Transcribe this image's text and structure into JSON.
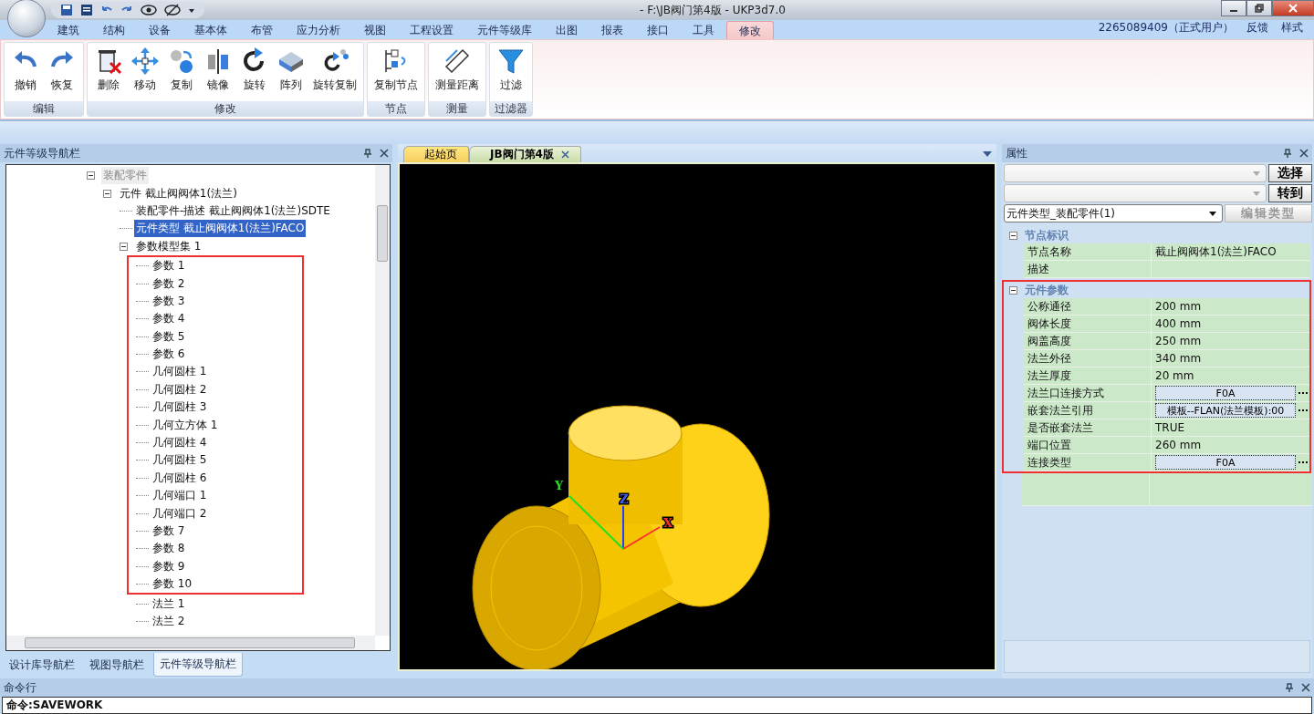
{
  "window": {
    "title": "- F:\\JB阀门第4版 - UKP3d7.0"
  },
  "menu": {
    "tabs": [
      {
        "label": "建筑",
        "selected": false
      },
      {
        "label": "结构",
        "selected": false
      },
      {
        "label": "设备",
        "selected": false
      },
      {
        "label": "基本体",
        "selected": false
      },
      {
        "label": "布管",
        "selected": false
      },
      {
        "label": "应力分析",
        "selected": false
      },
      {
        "label": "视图",
        "selected": false
      },
      {
        "label": "工程设置",
        "selected": false
      },
      {
        "label": "元件等级库",
        "selected": false
      },
      {
        "label": "出图",
        "selected": false
      },
      {
        "label": "报表",
        "selected": false
      },
      {
        "label": "接口",
        "selected": false
      },
      {
        "label": "工具",
        "selected": false
      },
      {
        "label": "修改",
        "selected": true
      }
    ],
    "user": "2265089409（正式用户）",
    "links": [
      "反馈",
      "样式"
    ]
  },
  "ribbon": {
    "groups": [
      {
        "label": "编辑",
        "buttons": [
          {
            "label": "撤销",
            "kind": "undo"
          },
          {
            "label": "恢复",
            "kind": "redo"
          }
        ]
      },
      {
        "label": "修改",
        "buttons": [
          {
            "label": "删除",
            "kind": "delete"
          },
          {
            "label": "移动",
            "kind": "move"
          },
          {
            "label": "复制",
            "kind": "copy"
          },
          {
            "label": "镜像",
            "kind": "mirror"
          },
          {
            "label": "旋转",
            "kind": "rotate"
          },
          {
            "label": "阵列",
            "kind": "array"
          },
          {
            "label": "旋转复制",
            "kind": "rotatecopy"
          }
        ]
      },
      {
        "label": "节点",
        "buttons": [
          {
            "label": "复制节点",
            "kind": "copynode"
          }
        ]
      },
      {
        "label": "测量",
        "buttons": [
          {
            "label": "测量距离",
            "kind": "measure"
          }
        ]
      },
      {
        "label": "过滤器",
        "buttons": [
          {
            "label": "过滤",
            "kind": "filter"
          }
        ]
      }
    ]
  },
  "left_panel": {
    "title": "元件等级导航栏",
    "tree": [
      {
        "label": "装配零件",
        "dimmed": true,
        "expanded": true,
        "children": [
          {
            "label": "元件 截止阀阀体1(法兰)",
            "selected": false,
            "expanded": true,
            "children": [
              {
                "label": "装配零件-描述 截止阀阀体1(法兰)SDTE",
                "selected": false
              },
              {
                "label": "元件类型 截止阀阀体1(法兰)FACO",
                "selected": true
              },
              {
                "label": "参数模型集 1",
                "selected": false,
                "expanded": true,
                "children": [
                  {
                    "label": "参数 1",
                    "annotated": true
                  },
                  {
                    "label": "参数 2",
                    "annotated": true
                  },
                  {
                    "label": "参数 3",
                    "annotated": true
                  },
                  {
                    "label": "参数 4",
                    "annotated": true
                  },
                  {
                    "label": "参数 5",
                    "annotated": true
                  },
                  {
                    "label": "参数 6",
                    "annotated": true
                  },
                  {
                    "label": "几何圆柱 1",
                    "annotated": true
                  },
                  {
                    "label": "几何圆柱 2",
                    "annotated": true
                  },
                  {
                    "label": "几何圆柱 3",
                    "annotated": true
                  },
                  {
                    "label": "几何立方体 1",
                    "annotated": true
                  },
                  {
                    "label": "几何圆柱 4",
                    "annotated": true
                  },
                  {
                    "label": "几何圆柱 5",
                    "annotated": true
                  },
                  {
                    "label": "几何圆柱 6",
                    "annotated": true
                  },
                  {
                    "label": "几何端口 1",
                    "annotated": true
                  },
                  {
                    "label": "几何端口 2",
                    "annotated": true
                  },
                  {
                    "label": "参数 7",
                    "annotated": true
                  },
                  {
                    "label": "参数 8",
                    "annotated": true
                  },
                  {
                    "label": "参数 9",
                    "annotated": true
                  },
                  {
                    "label": "参数 10",
                    "annotated": true
                  },
                  {
                    "label": "法兰 1",
                    "annotated": false
                  },
                  {
                    "label": "法兰 2",
                    "annotated": false
                  }
                ]
              }
            ]
          }
        ]
      }
    ],
    "tabs": [
      {
        "label": "设计库导航栏",
        "selected": false
      },
      {
        "label": "视图导航栏",
        "selected": false
      },
      {
        "label": "元件等级导航栏",
        "selected": true
      }
    ]
  },
  "document_tabs": [
    {
      "label": "起始页",
      "selected": false
    },
    {
      "label": "JB阀门第4版",
      "selected": true
    }
  ],
  "viewport": {
    "axes": [
      "Z",
      "Y",
      "X"
    ]
  },
  "properties": {
    "title": "属性",
    "buttons": [
      "选择",
      "转到"
    ],
    "type_combo": "元件类型_装配零件(1)",
    "edit_button": {
      "label": "编辑类型",
      "disabled": true
    },
    "sections": [
      {
        "title": "节点标识",
        "expanded": true,
        "annotated": false,
        "rows": [
          {
            "name": "节点名称",
            "value": "截止阀阀体1(法兰)FACO",
            "kind": "text"
          },
          {
            "name": "描述",
            "kind": "text"
          }
        ]
      },
      {
        "title": "元件参数",
        "expanded": true,
        "annotated": true,
        "rows": [
          {
            "name": "公称通径",
            "value": "200 mm",
            "kind": "text"
          },
          {
            "name": "阀体长度",
            "value": "400 mm",
            "kind": "text"
          },
          {
            "name": "阀盖高度",
            "value": "250 mm",
            "kind": "text"
          },
          {
            "name": "法兰外径",
            "value": "340 mm",
            "kind": "text"
          },
          {
            "name": "法兰厚度",
            "value": "20 mm",
            "kind": "text"
          },
          {
            "name": "法兰口连接方式",
            "value": "F0A",
            "kind": "button"
          },
          {
            "name": "嵌套法兰引用",
            "value": "模板--FLAN(法兰模板):00",
            "kind": "button"
          },
          {
            "name": "是否嵌套法兰",
            "value": "TRUE",
            "kind": "text"
          },
          {
            "name": "端口位置",
            "value": "260 mm",
            "kind": "text"
          },
          {
            "name": "连接类型",
            "value": "F0A",
            "kind": "button"
          }
        ]
      }
    ]
  },
  "command_line": {
    "title": "命令行",
    "lines": [
      "命令:SAVEWORK"
    ]
  }
}
